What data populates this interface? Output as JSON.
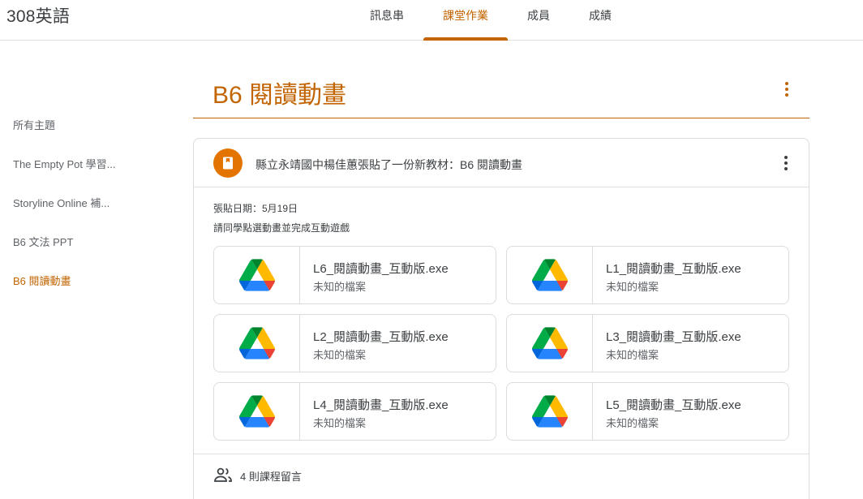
{
  "app": {
    "title": "308英語"
  },
  "tabs": [
    {
      "label": "訊息串"
    },
    {
      "label": "課堂作業"
    },
    {
      "label": "成員"
    },
    {
      "label": "成績"
    }
  ],
  "active_tab": "課堂作業",
  "sidebar": {
    "items": [
      {
        "label": "所有主題"
      },
      {
        "label": "The Empty Pot 學習..."
      },
      {
        "label": "Storyline Online 補..."
      },
      {
        "label": "B6 文法 PPT"
      },
      {
        "label": "B6 閱讀動畫"
      }
    ]
  },
  "topic": {
    "title": "B6 閱讀動畫"
  },
  "post": {
    "title": "縣立永靖國中楊佳蕙張貼了一份新教材：B6 閱讀動畫",
    "date": "張貼日期：5月19日",
    "description": "請同學點選動畫並完成互動遊戲",
    "attachments": [
      {
        "name": "L6_閱讀動畫_互動版.exe",
        "type": "未知的檔案"
      },
      {
        "name": "L1_閱讀動畫_互動版.exe",
        "type": "未知的檔案"
      },
      {
        "name": "L2_閱讀動畫_互動版.exe",
        "type": "未知的檔案"
      },
      {
        "name": "L3_閱讀動畫_互動版.exe",
        "type": "未知的檔案"
      },
      {
        "name": "L4_閱讀動畫_互動版.exe",
        "type": "未知的檔案"
      },
      {
        "name": "L5_閱讀動畫_互動版.exe",
        "type": "未知的檔案"
      }
    ],
    "comments": "4 則課程留言"
  },
  "colors": {
    "accent": "#c26401",
    "icon_bg": "#e37400"
  },
  "icons": {
    "attachment": "google-drive-icon",
    "post": "material-book-icon",
    "comments": "people-icon",
    "more": "more-vert-icon"
  }
}
